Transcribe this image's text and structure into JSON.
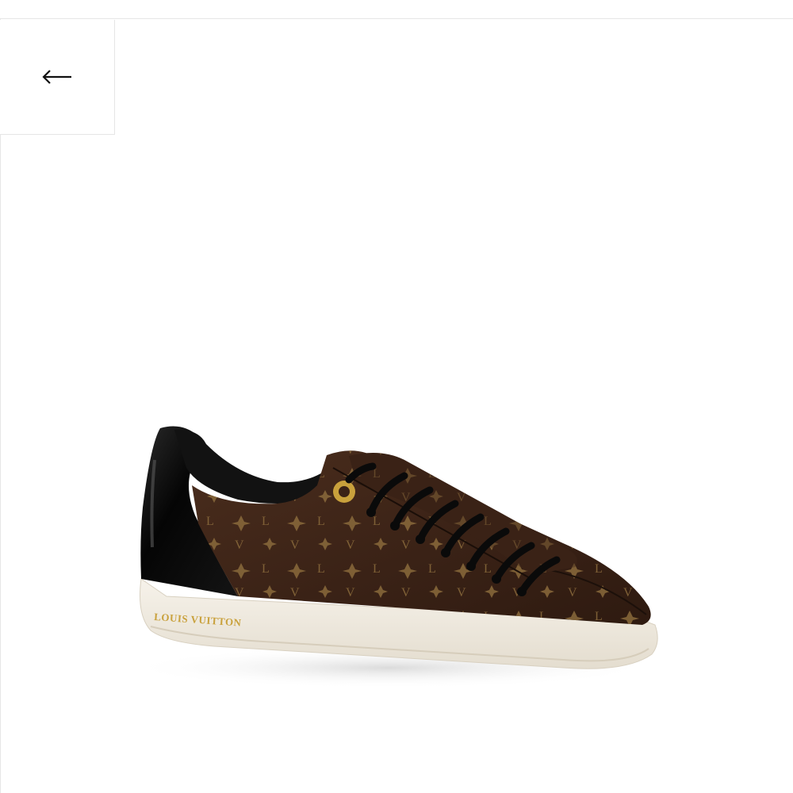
{
  "navigation": {
    "back_icon": "arrow-left-icon"
  },
  "product": {
    "image_description_icon": "sneaker-image",
    "brand_mark": "LOUIS VUITTON",
    "colors": {
      "canvas": "#3b2417",
      "monogram": "#8a6a3a",
      "patent": "#0c0c0c",
      "sole": "#f1ece2",
      "eyelet_gold": "#c9a13c"
    }
  }
}
